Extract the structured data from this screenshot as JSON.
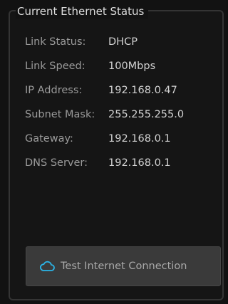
{
  "panel": {
    "title": "Current Ethernet Status"
  },
  "rows": [
    {
      "label": "Link Status:",
      "value": "DHCP"
    },
    {
      "label": "Link Speed:",
      "value": "100Mbps"
    },
    {
      "label": "IP Address:",
      "value": "192.168.0.47"
    },
    {
      "label": "Subnet Mask:",
      "value": "255.255.255.0"
    },
    {
      "label": "Gateway:",
      "value": "192.168.0.1"
    },
    {
      "label": "DNS Server:",
      "value": "192.168.0.1"
    }
  ],
  "test_button": {
    "label": "Test Internet Connection",
    "icon": "cloud-icon",
    "icon_color": "#2bb5e8"
  },
  "colors": {
    "background": "#121212",
    "panel_border": "#343434",
    "button_bg": "#3a3a3a",
    "label_text": "#9a9a9a",
    "value_text": "#d2d2d2"
  }
}
